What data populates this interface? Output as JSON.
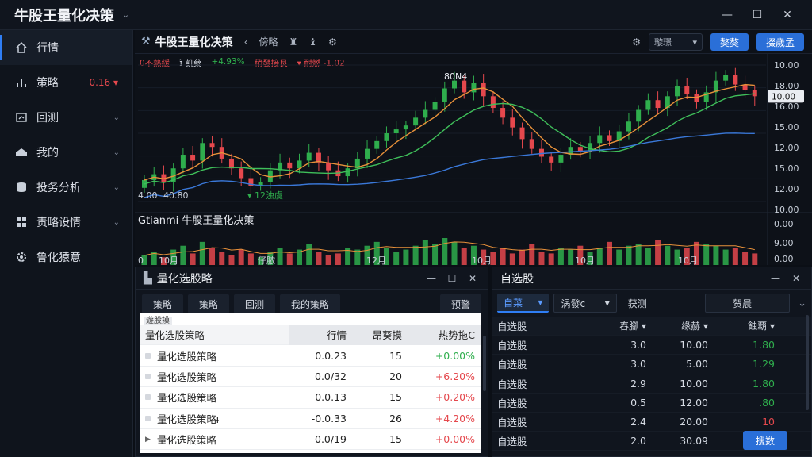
{
  "app": {
    "title": "牛股王量化决策"
  },
  "window": {
    "minimize": "—",
    "maximize": "☐",
    "close": "✕"
  },
  "sidebar": {
    "items": [
      {
        "label": "行情",
        "icon": "home-icon",
        "active": true
      },
      {
        "label": "策略",
        "icon": "bar-chart-icon",
        "value": "-0.16 ▾"
      },
      {
        "label": "回测",
        "icon": "backtest-icon"
      },
      {
        "label": "我的",
        "icon": "user-icon"
      },
      {
        "label": "投务分析",
        "icon": "database-icon"
      },
      {
        "label": "责略设情",
        "icon": "grid-icon"
      },
      {
        "label": "鲁化猿意",
        "icon": "gear-icon"
      }
    ]
  },
  "chart_toolbar": {
    "title": "牛股王量化决策",
    "items": [
      "傍略",
      "♜",
      "♝",
      "⚙"
    ],
    "select": "璇璟",
    "btn1": "獒獒",
    "btn2": "掇歲孟"
  },
  "indicators": [
    {
      "text": "0不熱緩",
      "color": "#e5484d"
    },
    {
      "text": "ɪ̃ 凯蘖",
      "color": "#d6dbe4"
    },
    {
      "text": "+4.93%",
      "color": "#2fae4d"
    },
    {
      "text": "稍發接艮",
      "color": "#e5484d"
    },
    {
      "text": "▾ 耐燃 -1.02",
      "color": "#e5484d"
    }
  ],
  "chart_labels": {
    "peak": "80N4",
    "left1": "4.00",
    "left2": "40.80",
    "sub_mark": "▾ 12浊虞",
    "volume_title": "Gtianmi 牛股王量化决策",
    "current_price": "10.00",
    "vol_bottom": "0"
  },
  "chart_data": {
    "type": "candlestick",
    "y_ticks": [
      "10.00",
      "18.00",
      "16.00",
      "15.00",
      "12.00",
      "15.00",
      "12.00",
      "10.00",
      "0.00",
      "9.00",
      "0.00"
    ],
    "x_ticks": [
      "10月",
      "仔脓",
      "12月",
      "10月",
      "10月",
      "10月"
    ],
    "candles": [
      [
        9.9,
        10.3
      ],
      [
        10.3,
        10.6
      ],
      [
        10.6,
        10.2
      ],
      [
        10.2,
        10.9
      ],
      [
        10.9,
        11.6
      ],
      [
        11.6,
        11.3
      ],
      [
        11.3,
        12.2
      ],
      [
        12.2,
        12.0
      ],
      [
        12.0,
        11.4
      ],
      [
        11.4,
        10.9
      ],
      [
        10.9,
        10.4
      ],
      [
        10.4,
        10.0
      ],
      [
        10.0,
        10.2
      ],
      [
        10.2,
        10.8
      ],
      [
        10.8,
        11.2
      ],
      [
        11.2,
        10.9
      ],
      [
        10.9,
        11.3
      ],
      [
        11.3,
        11.7
      ],
      [
        11.7,
        11.2
      ],
      [
        11.2,
        10.8
      ],
      [
        10.8,
        10.5
      ],
      [
        10.5,
        10.9
      ],
      [
        10.9,
        11.4
      ],
      [
        11.4,
        11.9
      ],
      [
        11.9,
        12.3
      ],
      [
        12.3,
        12.7
      ],
      [
        12.7,
        12.9
      ],
      [
        12.9,
        13.1
      ],
      [
        13.1,
        13.5
      ],
      [
        13.5,
        13.9
      ],
      [
        13.9,
        14.3
      ],
      [
        14.3,
        15.0
      ],
      [
        15.0,
        15.4
      ],
      [
        15.4,
        14.8
      ],
      [
        14.8,
        15.3
      ],
      [
        15.3,
        14.6
      ],
      [
        14.6,
        14.0
      ],
      [
        14.0,
        13.5
      ],
      [
        13.5,
        13.0
      ],
      [
        13.0,
        12.4
      ],
      [
        12.4,
        11.9
      ],
      [
        11.9,
        11.5
      ],
      [
        11.5,
        11.2
      ],
      [
        11.2,
        11.6
      ],
      [
        11.6,
        12.0
      ],
      [
        12.0,
        11.8
      ],
      [
        11.8,
        12.2
      ],
      [
        12.2,
        12.6
      ],
      [
        12.6,
        12.3
      ],
      [
        12.3,
        12.8
      ],
      [
        12.8,
        13.3
      ],
      [
        13.3,
        13.9
      ],
      [
        13.9,
        14.4
      ],
      [
        14.4,
        14.0
      ],
      [
        14.0,
        14.6
      ],
      [
        14.6,
        15.1
      ],
      [
        15.1,
        14.7
      ],
      [
        14.7,
        14.3
      ],
      [
        14.3,
        14.8
      ],
      [
        14.8,
        15.4
      ],
      [
        15.4,
        15.7
      ],
      [
        15.7,
        15.2
      ],
      [
        15.2,
        14.9
      ],
      [
        14.9,
        14.6
      ]
    ],
    "ma": [
      {
        "name": "MA5",
        "color": "#e8913a"
      },
      {
        "name": "MA10",
        "color": "#3fbf5a"
      },
      {
        "name": "MA30",
        "color": "#3a78d8"
      }
    ],
    "volume": [
      5,
      7,
      4,
      8,
      10,
      6,
      12,
      9,
      7,
      5,
      8,
      6,
      4,
      7,
      9,
      6,
      8,
      11,
      7,
      5,
      6,
      9,
      8,
      10,
      12,
      9,
      7,
      8,
      10,
      13,
      11,
      14,
      12,
      9,
      10,
      8,
      7,
      9,
      6,
      8,
      11,
      7,
      6,
      9,
      8,
      10,
      7,
      9,
      12,
      8,
      10,
      11,
      9,
      13,
      10,
      8,
      9,
      12,
      11,
      10,
      8,
      9,
      7,
      6
    ]
  },
  "strategy_panel": {
    "title": "量化选股略",
    "tabs": [
      "策略",
      "策略",
      "回测",
      "我的策略"
    ],
    "right_tab": "预警",
    "caption": "遊股摸",
    "columns": [
      "量化选股策略",
      "行情",
      "昂葵摸",
      "热势拖C"
    ],
    "rows": [
      {
        "name": "量化选股策略",
        "v1": "0.0.23",
        "v2": "15",
        "v3": "+0.00%",
        "dir": "up"
      },
      {
        "name": "量化选股策略",
        "v1": "0.0/32",
        "v2": "20",
        "v3": "+6.20%",
        "dir": "down"
      },
      {
        "name": "量化选股策略",
        "v1": "0.0.13",
        "v2": "15",
        "v3": "+0.20%",
        "dir": "down"
      },
      {
        "name": "量化选股策略ᵼ",
        "v1": "-0.0.33",
        "v2": "26",
        "v3": "+4.20%",
        "dir": "down"
      },
      {
        "name": "量化选股策略",
        "v1": "-0.0/19",
        "v2": "15",
        "v3": "+0.00%",
        "dir": "down"
      }
    ]
  },
  "watchlist_panel": {
    "title": "自选股",
    "tabs": [
      "自菜",
      "涡發ᴄ",
      "获测",
      "贺晨"
    ],
    "columns": [
      "自选股",
      "舂腳",
      "缘赫",
      "蝕覇"
    ],
    "rows": [
      {
        "name": "自选股",
        "v1": "3.0",
        "v2": "10.00",
        "v3": "1.80",
        "dir": "up"
      },
      {
        "name": "自选股",
        "v1": "3.0",
        "v2": "5.00",
        "v3": "1.29",
        "dir": "up"
      },
      {
        "name": "自选股",
        "v1": "2.9",
        "v2": "10.00",
        "v3": "1.80",
        "dir": "up"
      },
      {
        "name": "自选股",
        "v1": "0.5",
        "v2": "12.00",
        "v3": ".80",
        "dir": "up"
      },
      {
        "name": "自选股",
        "v1": "2.4",
        "v2": "20.00",
        "v3": "10",
        "dir": "down"
      },
      {
        "name": "自选股",
        "v1": "2.0",
        "v2": "30.09",
        "v3": "",
        "dir": "up"
      }
    ],
    "button": "搜数"
  },
  "colors": {
    "accent": "#2f7ef5",
    "up": "#2fae4d",
    "down": "#e5484d"
  }
}
